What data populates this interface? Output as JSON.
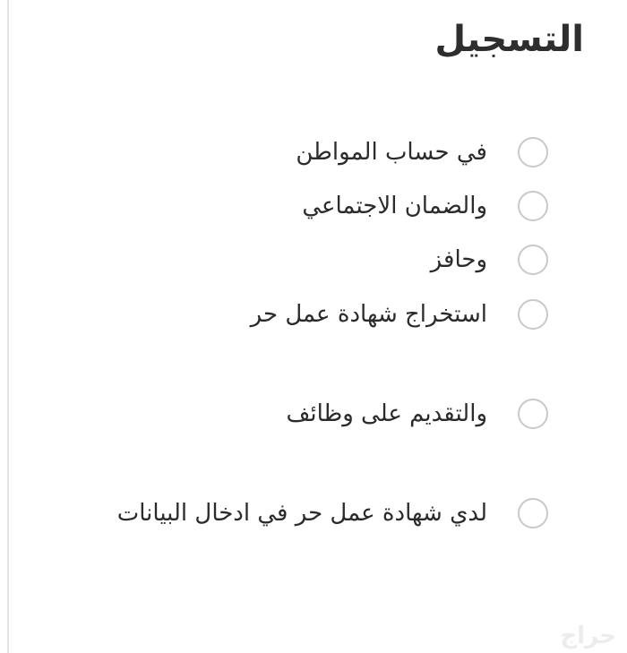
{
  "form": {
    "title": "التسجيل",
    "options": [
      {
        "label": "في حساب المواطن"
      },
      {
        "label": "والضمان الاجتماعي"
      },
      {
        "label": "وحافز"
      },
      {
        "label": "استخراج شهادة عمل حر"
      },
      {
        "label": "والتقديم على وظائف"
      },
      {
        "label": "لدي شهادة عمل حر في ادخال البيانات"
      }
    ]
  },
  "watermark": {
    "text": "حراج"
  },
  "icons": {
    "radio": "radio-unselected-icon"
  }
}
